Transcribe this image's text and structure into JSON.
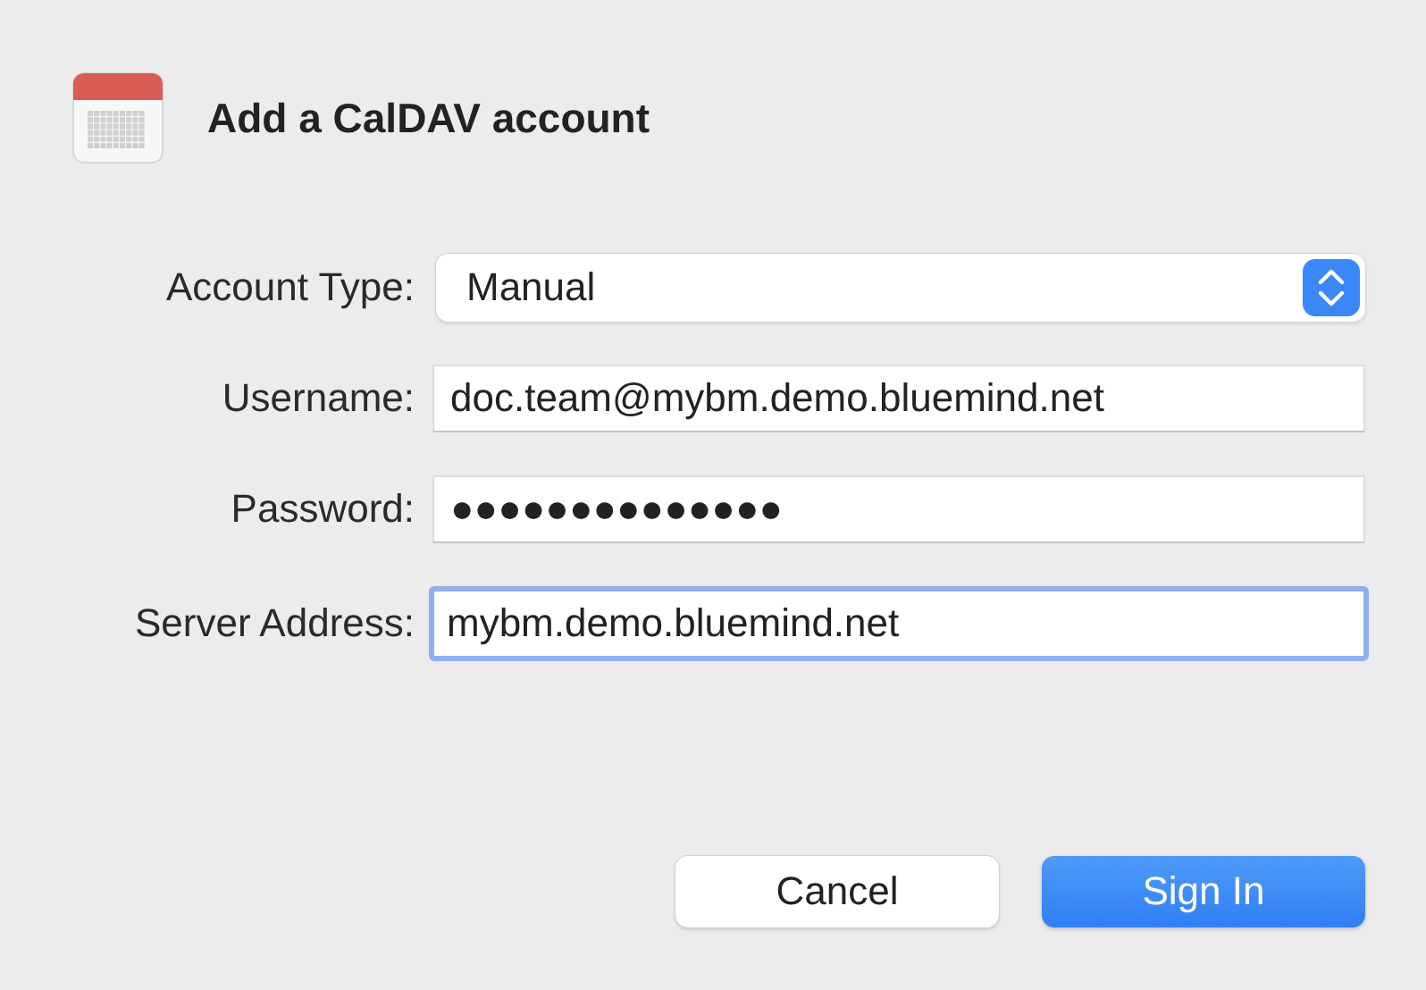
{
  "dialog": {
    "title": "Add a CalDAV account"
  },
  "fields": [
    {
      "kind": "select",
      "label": "Account Type:",
      "value": "Manual",
      "focused": false
    },
    {
      "kind": "text",
      "label": "Username:",
      "value": "doc.team@mybm.demo.bluemind.net",
      "focused": false
    },
    {
      "kind": "text",
      "label": "Password:",
      "value": "●●●●●●●●●●●●●●",
      "focused": false
    },
    {
      "kind": "text",
      "label": "Server Address:",
      "value": "mybm.demo.bluemind.net",
      "focused": true
    }
  ],
  "buttons": [
    {
      "label": "Cancel",
      "default": false
    },
    {
      "label": "Sign In",
      "default": true
    }
  ]
}
